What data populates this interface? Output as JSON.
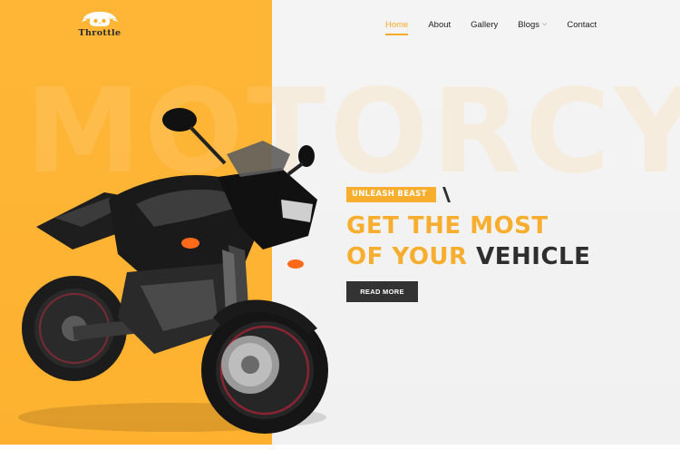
{
  "brand": {
    "name": "Throttle",
    "logo_icon": "skull-helmet-icon"
  },
  "nav": {
    "items": [
      {
        "label": "Home",
        "active": true
      },
      {
        "label": "About",
        "active": false
      },
      {
        "label": "Gallery",
        "active": false
      },
      {
        "label": "Blogs",
        "active": false,
        "has_dropdown": true
      },
      {
        "label": "Contact",
        "active": false
      }
    ]
  },
  "hero": {
    "background_word": "MOTORCYCLE",
    "badge": "UNLEASH BEAST",
    "headline_line1": "GET THE MOST",
    "headline_line2_accent": "OF YOUR",
    "headline_line2_dark": "VEHICLE",
    "cta_label": "READ MORE",
    "image": "black-sport-motorcycle"
  },
  "colors": {
    "accent": "#f7ad2e",
    "dark": "#2e2e2e",
    "panel_yellow": "#fdb12f",
    "panel_gray": "#f3f3f3"
  }
}
